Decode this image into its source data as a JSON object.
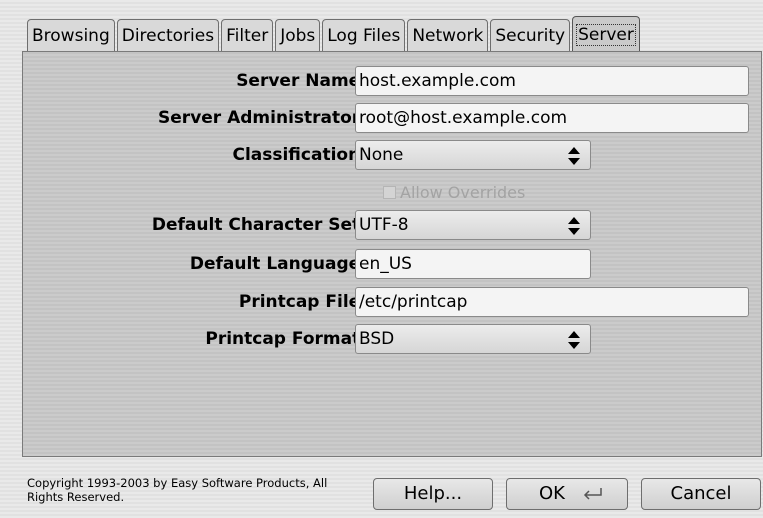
{
  "tabs": [
    {
      "label": "Browsing"
    },
    {
      "label": "Directories"
    },
    {
      "label": "Filter"
    },
    {
      "label": "Jobs"
    },
    {
      "label": "Log Files"
    },
    {
      "label": "Network"
    },
    {
      "label": "Security"
    },
    {
      "label": "Server",
      "active": true
    }
  ],
  "form": {
    "server_name": {
      "label": "Server Name:",
      "value": "host.example.com"
    },
    "server_admin": {
      "label": "Server Administrator:",
      "value": "root@host.example.com"
    },
    "classification": {
      "label": "Classification:",
      "value": "None"
    },
    "allow_overrides": {
      "label": "Allow Overrides",
      "checked": false,
      "enabled": false
    },
    "default_charset": {
      "label": "Default Character Set:",
      "value": "UTF-8"
    },
    "default_language": {
      "label": "Default Language:",
      "value": "en_US"
    },
    "printcap_file": {
      "label": "Printcap File:",
      "value": "/etc/printcap"
    },
    "printcap_format": {
      "label": "Printcap Format:",
      "value": "BSD"
    }
  },
  "footer": {
    "copyright": "Copyright 1993-2003 by Easy Software Products, All Rights Reserved.",
    "help_label": "Help...",
    "ok_label": "OK",
    "cancel_label": "Cancel"
  },
  "icons": {
    "select_arrows": "updown-arrows-icon",
    "ok_shortcut": "enter-key-icon"
  }
}
